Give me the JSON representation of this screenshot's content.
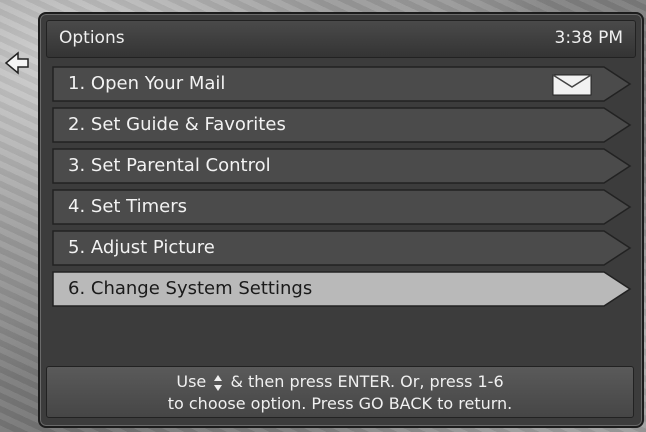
{
  "header": {
    "title": "Options",
    "time": "3:38 PM"
  },
  "menu": {
    "items": [
      {
        "label": "1.  Open Your Mail",
        "icon": "mail-icon",
        "selected": false
      },
      {
        "label": "2.  Set Guide & Favorites",
        "selected": false
      },
      {
        "label": "3.  Set Parental Control",
        "selected": false
      },
      {
        "label": "4.  Set Timers",
        "selected": false
      },
      {
        "label": "5.  Adjust Picture",
        "selected": false
      },
      {
        "label": "6.  Change System Settings",
        "selected": true
      }
    ]
  },
  "footer": {
    "line1_prefix": "Use",
    "line1_suffix": "& then press ENTER.  Or, press 1-6",
    "line2": "to choose option.  Press GO BACK to return."
  },
  "colors": {
    "panel": "#3c3c3c",
    "item": "#4b4b4b",
    "item_selected": "#b9b9b9",
    "text": "#f2f2f2"
  }
}
